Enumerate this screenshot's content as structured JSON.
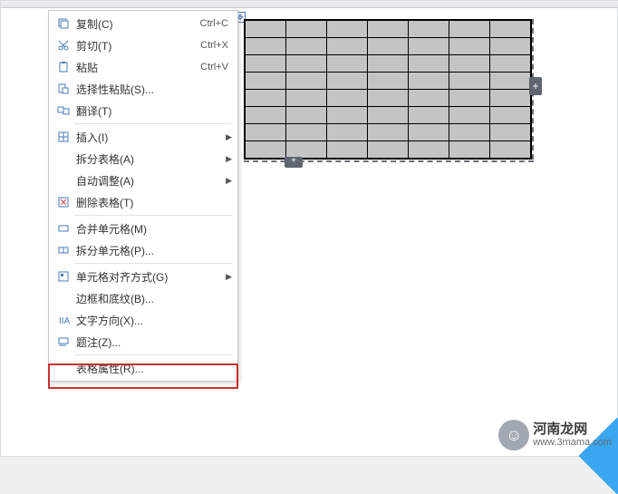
{
  "menu": {
    "copy": {
      "label": "复制(C)",
      "shortcut": "Ctrl+C"
    },
    "cut": {
      "label": "剪切(T)",
      "shortcut": "Ctrl+X"
    },
    "paste": {
      "label": "粘贴",
      "shortcut": "Ctrl+V"
    },
    "paste_special": {
      "label": "选择性粘贴(S)..."
    },
    "translate": {
      "label": "翻译(T)"
    },
    "insert": {
      "label": "插入(I)"
    },
    "split_table": {
      "label": "拆分表格(A)"
    },
    "autofit": {
      "label": "自动调整(A)"
    },
    "delete_table": {
      "label": "删除表格(T)"
    },
    "merge_cells": {
      "label": "合并单元格(M)"
    },
    "split_cells": {
      "label": "拆分单元格(P)..."
    },
    "cell_align": {
      "label": "单元格对齐方式(G)"
    },
    "borders": {
      "label": "边框和底纹(B)..."
    },
    "text_dir": {
      "label": "文字方向(X)..."
    },
    "caption": {
      "label": "题注(Z)..."
    },
    "table_props": {
      "label": "表格属性(R)..."
    }
  },
  "spreadsheet": {
    "rows": 8,
    "cols": 7
  },
  "handles": {
    "right": "+",
    "bottom": "+"
  },
  "watermark": {
    "title": "河南龙网",
    "url": "www.3mama.com"
  }
}
